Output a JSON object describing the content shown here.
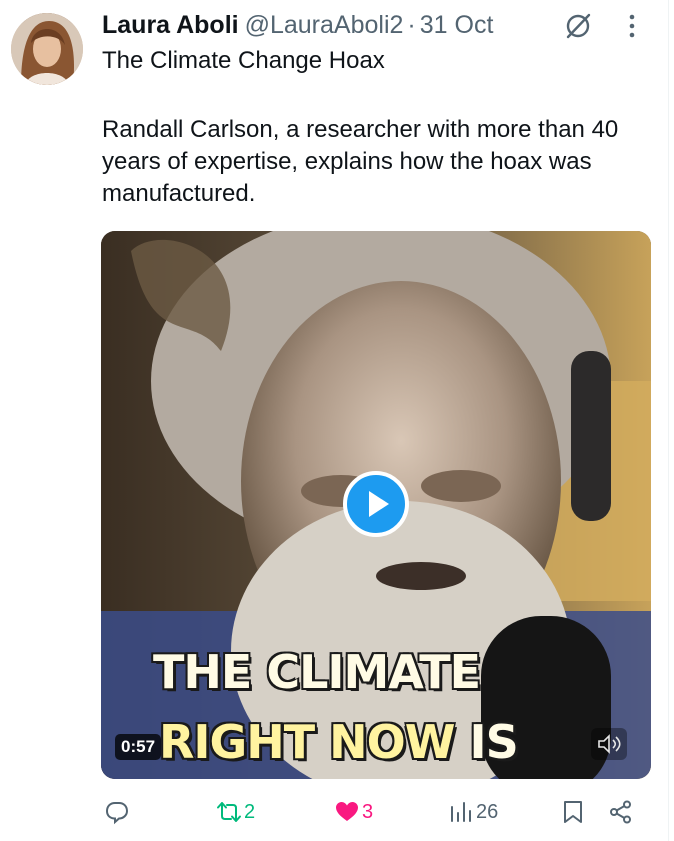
{
  "tweet": {
    "author_name": "Laura Aboli",
    "author_handle": "@LauraAboli2",
    "separator": "·",
    "date": "31 Oct",
    "title": "The Climate Change Hoax",
    "body": "Randall Carlson, a researcher with more than 40 years of expertise, explains how the hoax was manufactured."
  },
  "media": {
    "caption_line1": "THE CLIMATE",
    "caption_line2_a": "RIGHT NOW",
    "caption_line2_b": " IS",
    "duration": "0:57"
  },
  "actions": {
    "reply_count": "",
    "retweet_count": "2",
    "like_count": "3",
    "views_count": "26"
  },
  "icons": {
    "header": [
      "grok-icon",
      "more-icon"
    ],
    "actions": [
      "reply-icon",
      "retweet-icon",
      "like-icon",
      "views-icon",
      "bookmark-icon",
      "share-icon"
    ],
    "media": [
      "play-icon",
      "mute-icon"
    ]
  },
  "colors": {
    "accent": "#1d9bf0",
    "retweet": "#00ba7c",
    "like": "#f91880",
    "muted": "#536471"
  }
}
